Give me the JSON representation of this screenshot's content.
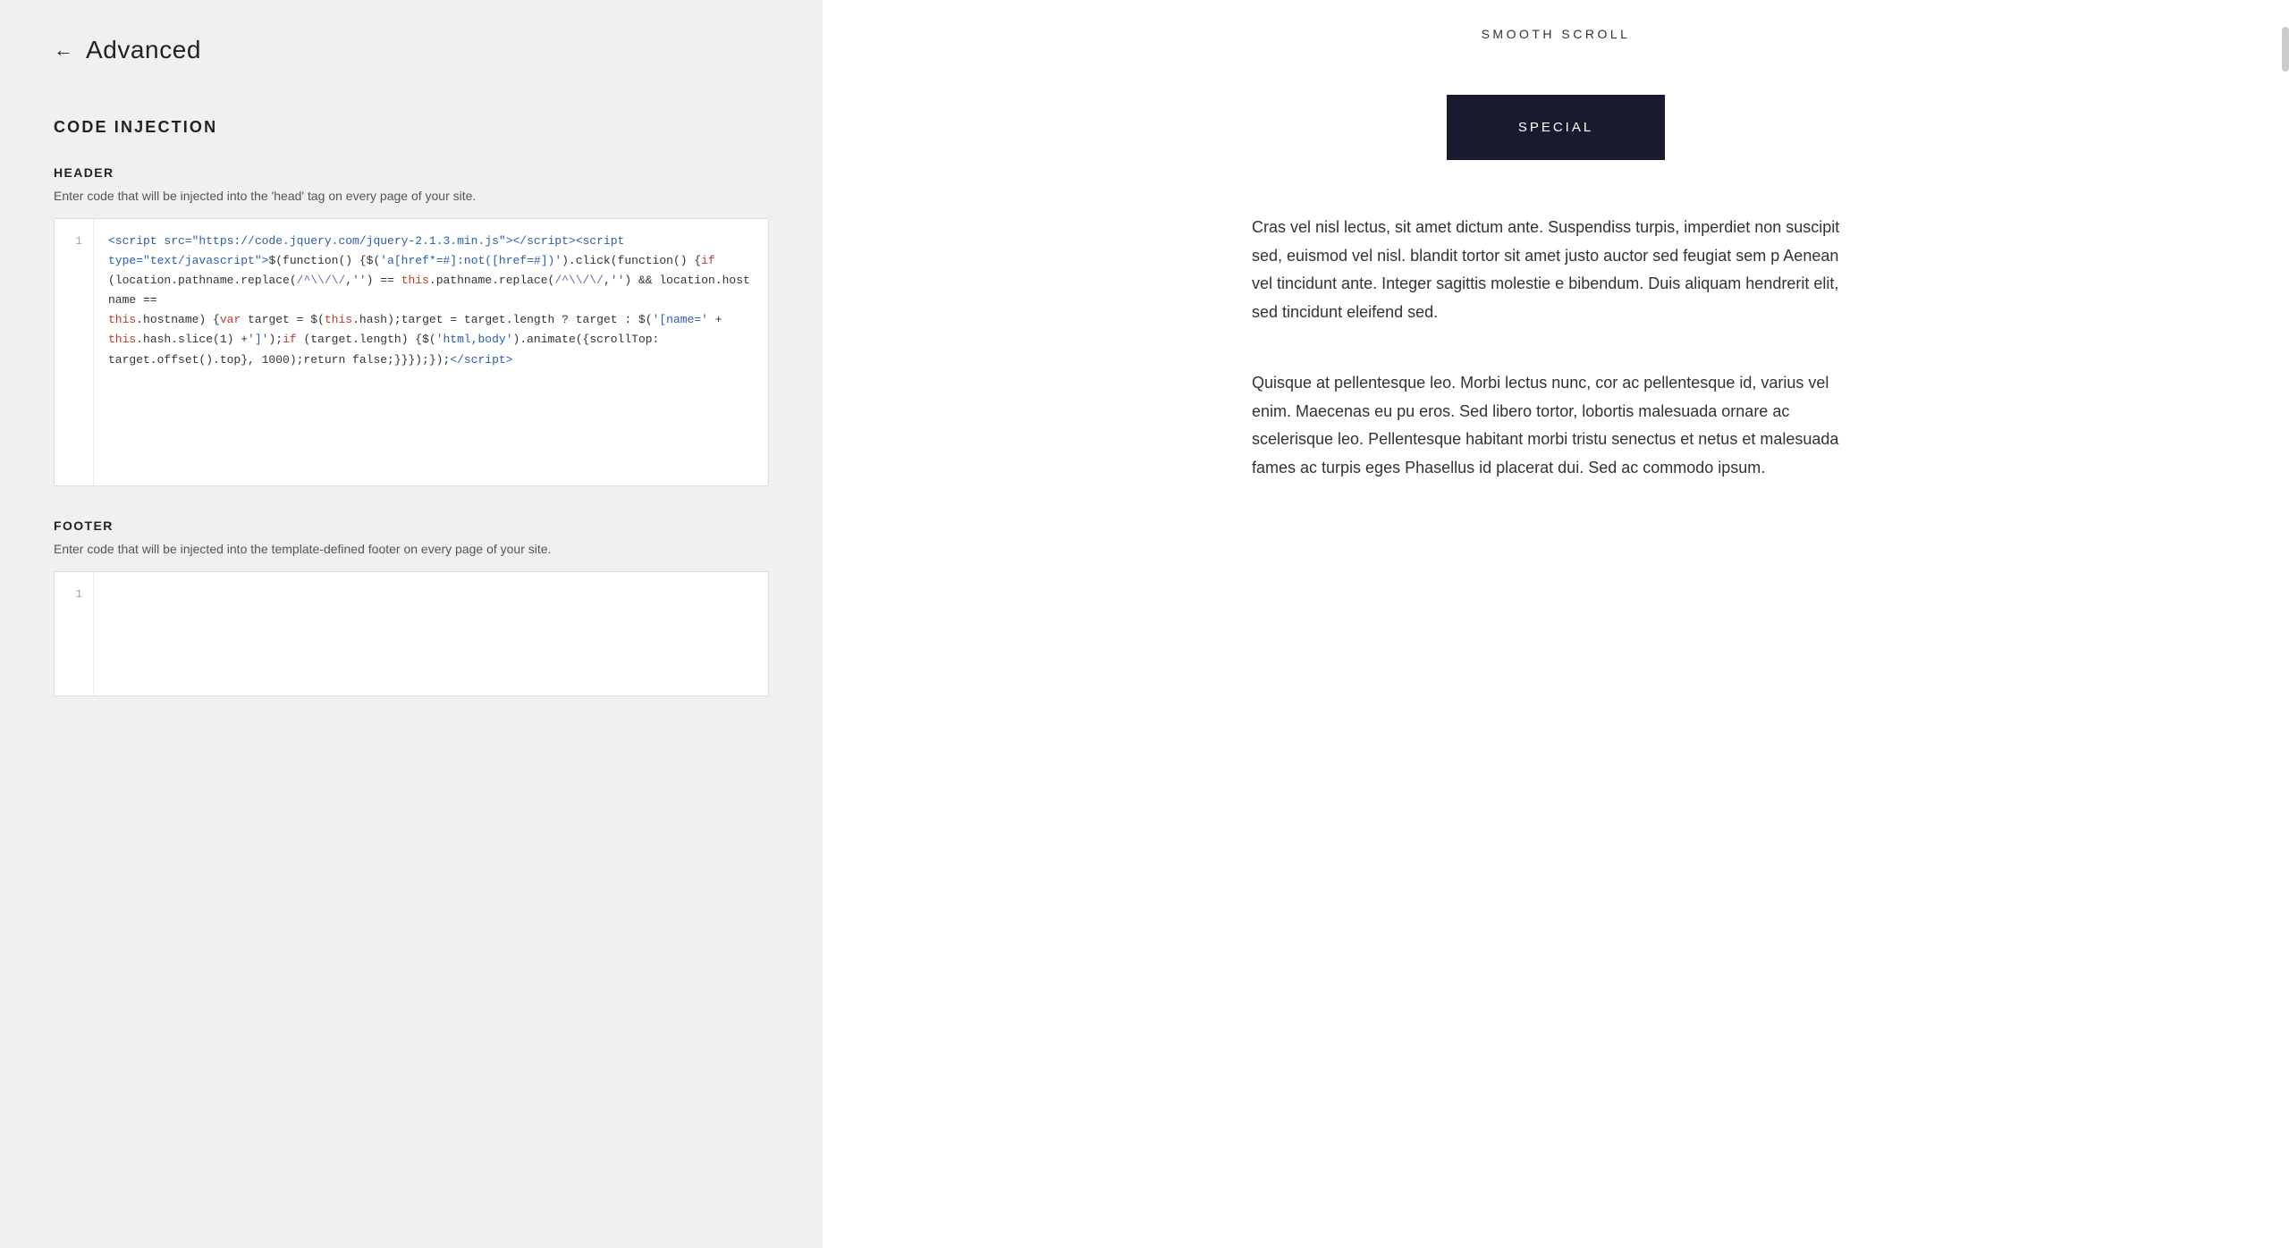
{
  "nav": {
    "back_arrow": "←",
    "back_label": "Advanced"
  },
  "left": {
    "section_title": "CODE INJECTION",
    "header": {
      "label": "HEADER",
      "description": "Enter code that will be injected into the 'head' tag on every page of your site.",
      "line_number": "1",
      "code_line1": "<script src=\"https://code.jquery.com/jquery-2.1.3.min.js\"></script><script",
      "code_line2": "type=\"text/javascript\">$(function() {$('a[href*=#]:not([href=#])')",
      "code_line2b": ".click(function() {if",
      "code_line3": "(location.pathname.replace(/^\\//, '') == this.pathname.replace(/^\\//, '') && location.hostname ==",
      "code_line4": "this.hostname) {var target = $(this.hash);target = target.length ? target : $('[name=' +",
      "code_line5": "this.hash.slice(1) +']');if (target.length) {$('html,body').animate({scrollTop:",
      "code_line6": "target.offset().top}, 1000);return false;}}});});</script>"
    },
    "footer": {
      "label": "FOOTER",
      "description": "Enter code that will be injected into the template-defined footer on every page of your site.",
      "line_number": "1"
    }
  },
  "right": {
    "preview_title": "SMOOTH SCROLL",
    "special_button_label": "SPECIAL",
    "paragraph1": "Cras vel nisl lectus, sit amet dictum ante. Suspendiss turpis, imperdiet non suscipit sed, euismod vel nisl. blandit tortor sit amet justo auctor sed feugiat sem p Aenean vel tincidunt ante. Integer sagittis molestie e bibendum. Duis aliquam hendrerit elit, sed tincidunt eleifend sed.",
    "paragraph2": "Quisque at pellentesque leo. Morbi lectus nunc, cor ac pellentesque id, varius vel enim. Maecenas eu pu eros. Sed libero tortor, lobortis malesuada ornare ac scelerisque leo. Pellentesque habitant morbi tristu senectus et netus et malesuada fames ac turpis eges Phasellus id placerat dui. Sed ac commodo ipsum."
  }
}
